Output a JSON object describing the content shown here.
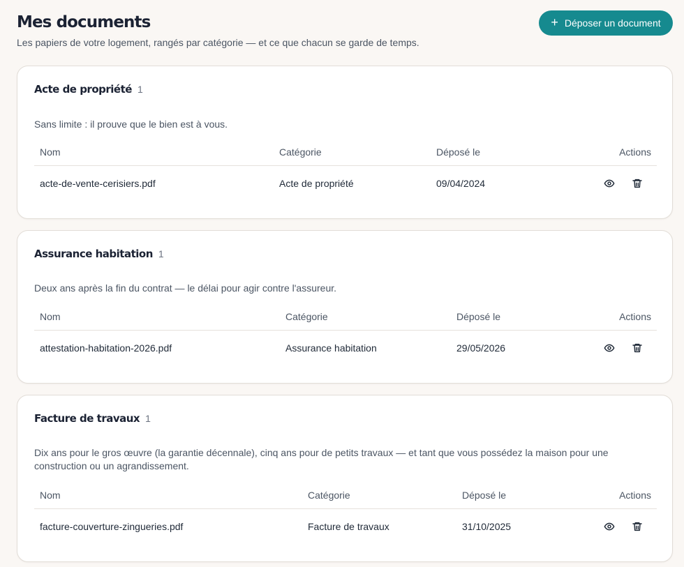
{
  "header": {
    "title": "Mes documents",
    "subtitle": "Les papiers de votre logement, rangés par catégorie — et ce que chacun se garde de temps.",
    "upload_label": "Déposer un document",
    "upload_icon": "plus-icon"
  },
  "table_headers": {
    "name": "Nom",
    "category": "Catégorie",
    "date": "Déposé le",
    "actions": "Actions"
  },
  "sections": [
    {
      "title": "Acte de propriété",
      "count": "1",
      "description": "Sans limite : il prouve que le bien est à vous.",
      "rows": [
        {
          "name": "acte-de-vente-cerisiers.pdf",
          "category": "Acte de propriété",
          "date": "09/04/2024"
        }
      ]
    },
    {
      "title": "Assurance habitation",
      "count": "1",
      "description": "Deux ans après la fin du contrat — le délai pour agir contre l'assureur.",
      "rows": [
        {
          "name": "attestation-habitation-2026.pdf",
          "category": "Assurance habitation",
          "date": "29/05/2026"
        }
      ]
    },
    {
      "title": "Facture de travaux",
      "count": "1",
      "description": "Dix ans pour le gros œuvre (la garantie décennale), cinq ans pour de petits travaux — et tant que vous possédez la maison pour une construction ou un agrandissement.",
      "rows": [
        {
          "name": "facture-couverture-zingueries.pdf",
          "category": "Facture de travaux",
          "date": "31/10/2025"
        }
      ]
    }
  ],
  "row_actions": [
    "eye-icon",
    "trash-icon"
  ]
}
